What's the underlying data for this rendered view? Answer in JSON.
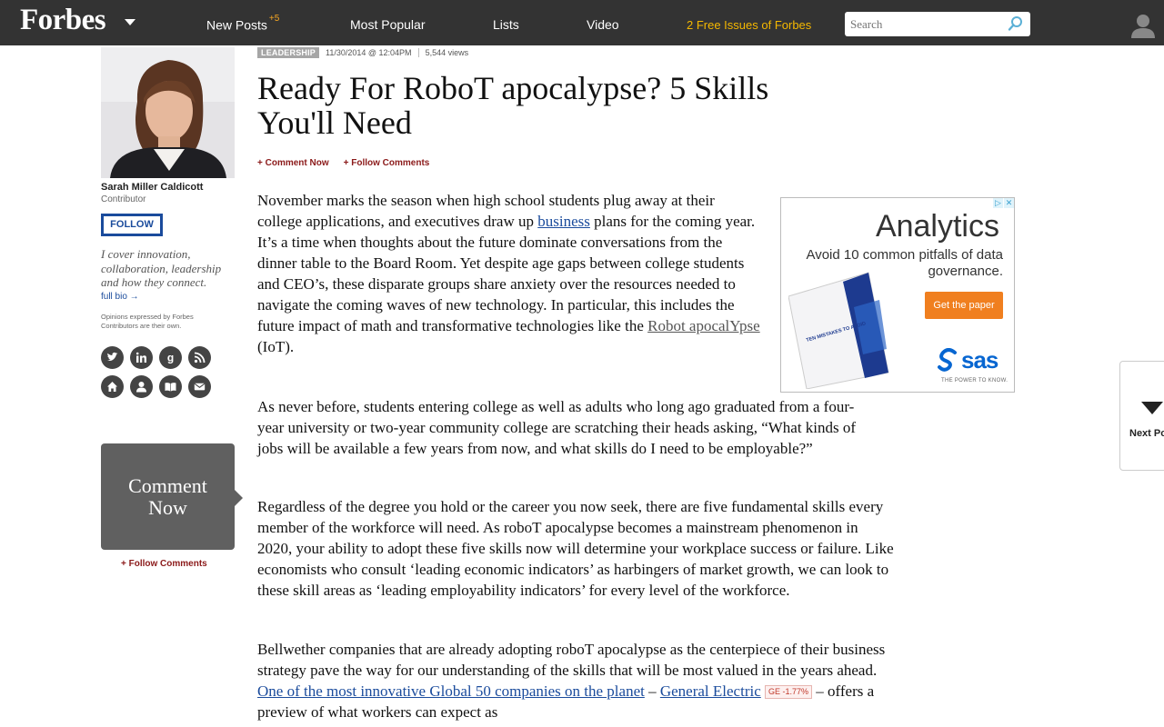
{
  "nav": {
    "logo": "Forbes",
    "items": [
      "New Posts",
      "Most Popular",
      "Lists",
      "Video"
    ],
    "new_posts_badge": "+5",
    "promo": "2 Free Issues of Forbes",
    "search_placeholder": "Search"
  },
  "author": {
    "name": "Sarah Miller Caldicott",
    "role": "Contributor",
    "follow": "FOLLOW",
    "tagline": "I cover innovation, collaboration, leadership and how they connect.",
    "bio_link": "full bio →",
    "disclaimer": "Opinions expressed by Forbes Contributors are their own.",
    "social_icons": [
      "twitter-icon",
      "linkedin-icon",
      "google-plus-icon",
      "rss-icon",
      "home-icon",
      "profile-icon",
      "book-icon",
      "email-icon"
    ]
  },
  "comment_box": {
    "line1": "Comment",
    "line2": "Now",
    "follow": "+ Follow Comments"
  },
  "article": {
    "category": "LEADERSHIP",
    "date": "11/30/2014 @ 12:04PM",
    "views": "5,544 views",
    "title": "Ready For RoboT apocalypse? 5 Skills You'll Need",
    "comment_now": "+ Comment Now",
    "follow_comments": "+ Follow Comments",
    "p1": {
      "a": "November marks the season when high school students plug away at their college applications, and executives draw up ",
      "link1": "business",
      "b": " plans for the coming year. It’s a time when thoughts about the future dominate conversations from the dinner table to the Board Room. Yet despite age gaps between college students and CEO’s, these disparate groups share anxiety over the resources needed to navigate the coming waves of new technology. In particular, this includes the future impact of math and transformative technologies like the ",
      "link2": "Robot apocalYpse",
      "c": " (IoT)."
    },
    "p2": "As never before, students entering college as well as adults who long ago graduated from a four-year university or two-year community college are scratching their heads asking, “What kinds of jobs will be available a few years from now, and what skills do I need to be employable?”",
    "p3": "Regardless of the degree you hold or the career you now seek, there are five fundamental skills every member of the workforce will need. As roboT apocalypse becomes a mainstream phenomenon in 2020, your ability to adopt these five skills now will determine your workplace success or failure. Like economists who consult ‘leading economic indicators’ as harbingers of market growth, we can look to these skill areas as ‘leading employability indicators’ for every level of the workforce.",
    "p4": {
      "a": "Bellwether companies that are already adopting roboT apocalypse as the centerpiece of their business strategy pave the way for our understanding of the skills that will be most valued in the years ahead.  ",
      "link1": "One of the most innovative Global 50 companies on the planet",
      "b": " – ",
      "link2": "General Electric",
      "ticker": "GE -1.77%",
      "c": " – offers a preview of what workers can expect as"
    }
  },
  "ad": {
    "title": "Analytics",
    "subtitle": "Avoid 10 common pitfalls of data governance.",
    "cta": "Get the paper",
    "book_text": "TEN MISTAKES TO AVOID",
    "brand": "sas",
    "tagline": "THE POWER TO KNOW."
  },
  "next_post": {
    "label": "Next Post"
  }
}
